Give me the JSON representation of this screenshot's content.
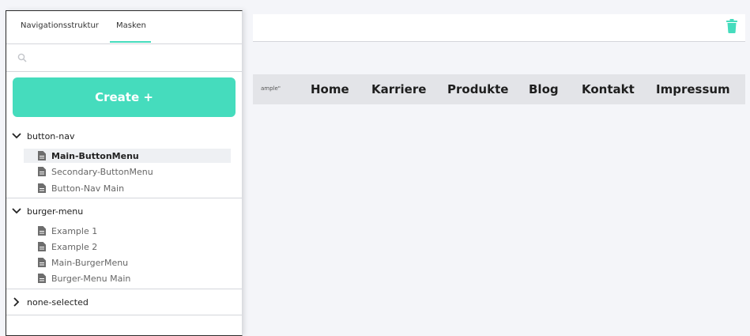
{
  "tabs": {
    "navigation": "Navigationsstruktur",
    "masks": "Masken"
  },
  "search": {
    "placeholder": ""
  },
  "create_button": "Create +",
  "groups": [
    {
      "name": "button-nav",
      "expanded": true,
      "items": [
        "Main-ButtonMenu",
        "Secondary-ButtonMenu",
        "Button-Nav Main"
      ],
      "selected": "Main-ButtonMenu"
    },
    {
      "name": "burger-menu",
      "expanded": true,
      "items": [
        "Example 1",
        "Example 2",
        "Main-BurgerMenu",
        "Burger-Menu Main"
      ]
    },
    {
      "name": "none-selected",
      "expanded": false,
      "items": []
    }
  ],
  "preview": {
    "example_tag": "ample\"",
    "links": [
      "Home",
      "Karriere",
      "Produkte",
      "Blog",
      "Kontakt",
      "Impressum"
    ]
  },
  "icons": {
    "search": "search-icon",
    "trash": "trash-icon",
    "document": "document-icon",
    "chevron": "chevron-icon"
  },
  "colors": {
    "accent": "#45dcbd",
    "sidebar_bg": "#ffffff",
    "page_bg": "#f4f5f9",
    "navbar_bg": "#e3e4e8"
  }
}
